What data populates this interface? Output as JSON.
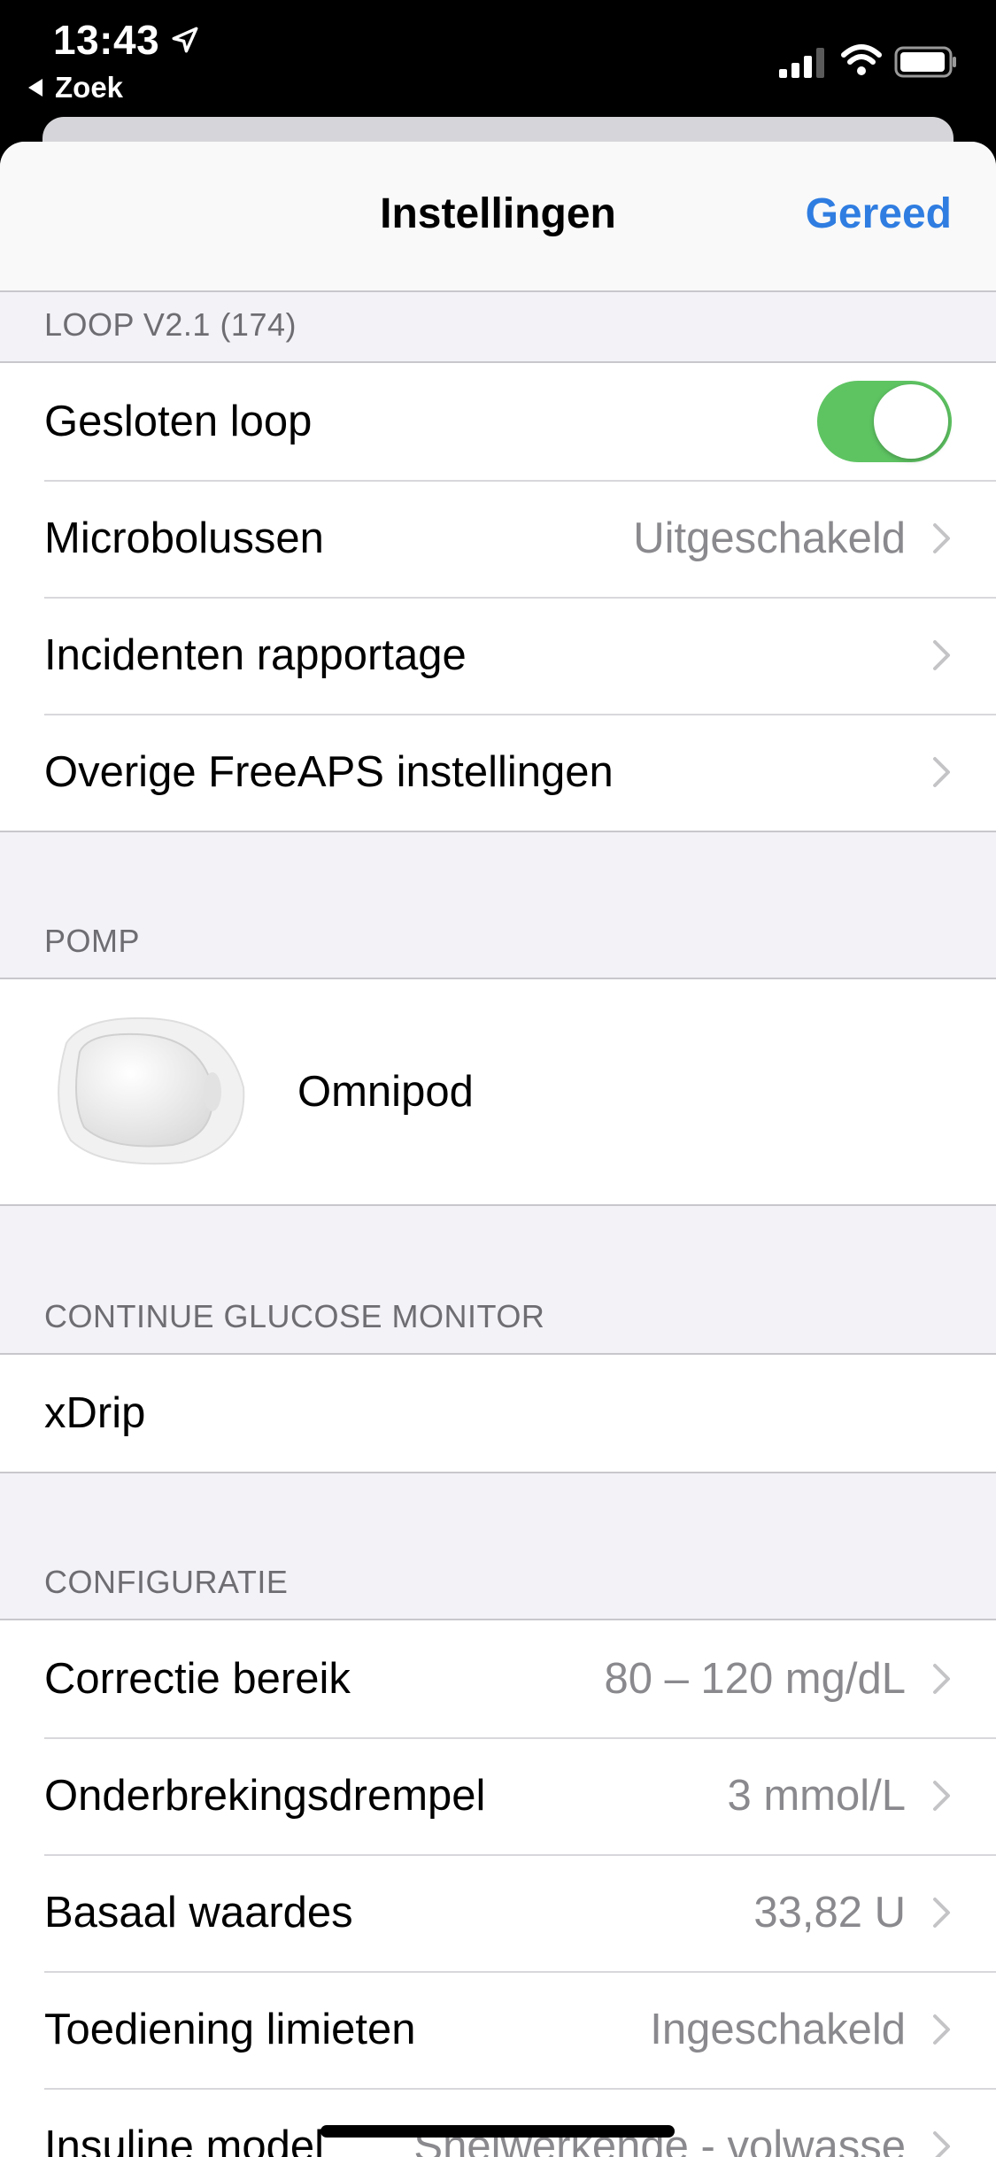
{
  "status_bar": {
    "time": "13:43",
    "back_app": "Zoek",
    "icons": [
      "location-arrow-icon",
      "signal-icon",
      "wifi-icon",
      "battery-icon"
    ]
  },
  "nav": {
    "title": "Instellingen",
    "done": "Gereed"
  },
  "sections": {
    "loop": {
      "header": "LOOP V2.1 (174)",
      "closed_loop_label": "Gesloten loop",
      "closed_loop_on": true,
      "microbolus_label": "Microbolussen",
      "microbolus_value": "Uitgeschakeld",
      "incidents_label": "Incidenten rapportage",
      "other_label": "Overige FreeAPS instellingen"
    },
    "pump": {
      "header": "POMP",
      "name": "Omnipod"
    },
    "cgm": {
      "header": "CONTINUE GLUCOSE MONITOR",
      "name": "xDrip"
    },
    "config": {
      "header": "CONFIGURATIE",
      "rows": [
        {
          "label": "Correctie bereik",
          "value": "80 – 120 mg/dL"
        },
        {
          "label": "Onderbrekingsdrempel",
          "value": "3 mmol/L"
        },
        {
          "label": "Basaal waardes",
          "value": "33,82 U"
        },
        {
          "label": "Toediening limieten",
          "value": "Ingeschakeld"
        },
        {
          "label": "Insuline model",
          "value": "Snelwerkende - volwasse"
        }
      ]
    }
  },
  "colors": {
    "accent": "#2f7de1",
    "toggle_on": "#5ec462",
    "background": "#f2f2f7",
    "secondary_text": "#8a8a8e"
  }
}
